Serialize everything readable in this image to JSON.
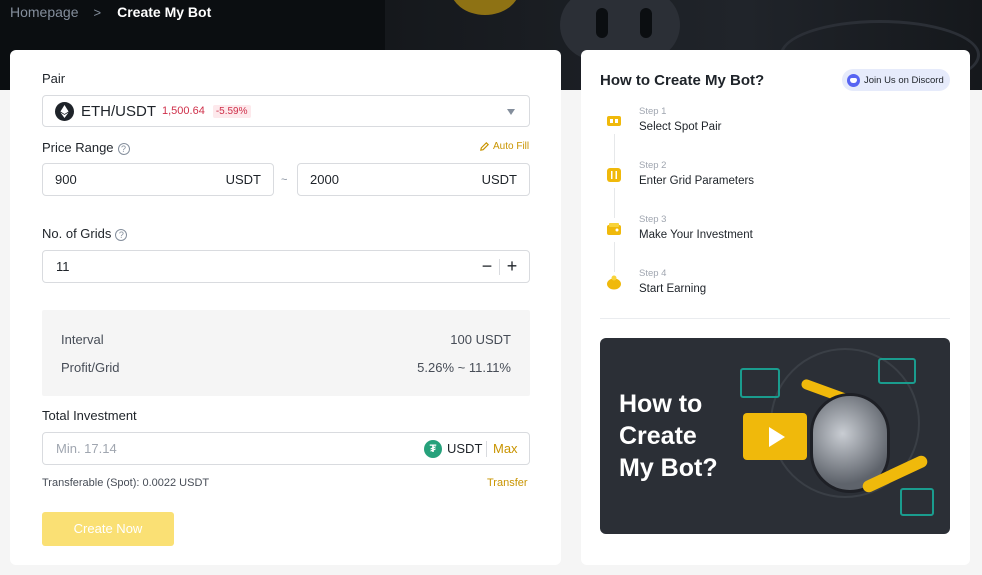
{
  "breadcrumb": {
    "home": "Homepage",
    "separator": ">",
    "current": "Create My Bot"
  },
  "form": {
    "pair_label": "Pair",
    "pair": {
      "name": "ETH/USDT",
      "price": "1,500.64",
      "change": "-5.59%",
      "change_color": "#cf304a"
    },
    "price_range_label": "Price Range",
    "auto_fill": "Auto Fill",
    "range_low": {
      "value": "900",
      "unit": "USDT"
    },
    "range_separator": "~",
    "range_high": {
      "value": "2000",
      "unit": "USDT"
    },
    "grids_label": "No. of Grids",
    "grids_value": "11",
    "decrement": "−",
    "increment": "+",
    "interval_label": "Interval",
    "interval_value": "100 USDT",
    "profit_label": "Profit/Grid",
    "profit_value": "5.26% ~ 11.11%",
    "investment_label": "Total Investment",
    "investment_placeholder": "Min. 17.14",
    "investment_unit": "USDT",
    "tether_symbol": "₮",
    "max": "Max",
    "transferable": "Transferable (Spot): 0.0022 USDT",
    "transfer": "Transfer",
    "create_button": "Create Now",
    "accent_color": "#f0b90b"
  },
  "guide": {
    "title": "How to Create My Bot?",
    "discord": "Join Us on Discord",
    "steps": [
      {
        "number": "Step 1",
        "title": "Select Spot Pair"
      },
      {
        "number": "Step 2",
        "title": "Enter Grid Parameters"
      },
      {
        "number": "Step 3",
        "title": "Make Your Investment"
      },
      {
        "number": "Step 4",
        "title": "Start Earning"
      }
    ],
    "video": {
      "line1": "How to",
      "line2": "Create",
      "line3": "My Bot?"
    }
  }
}
